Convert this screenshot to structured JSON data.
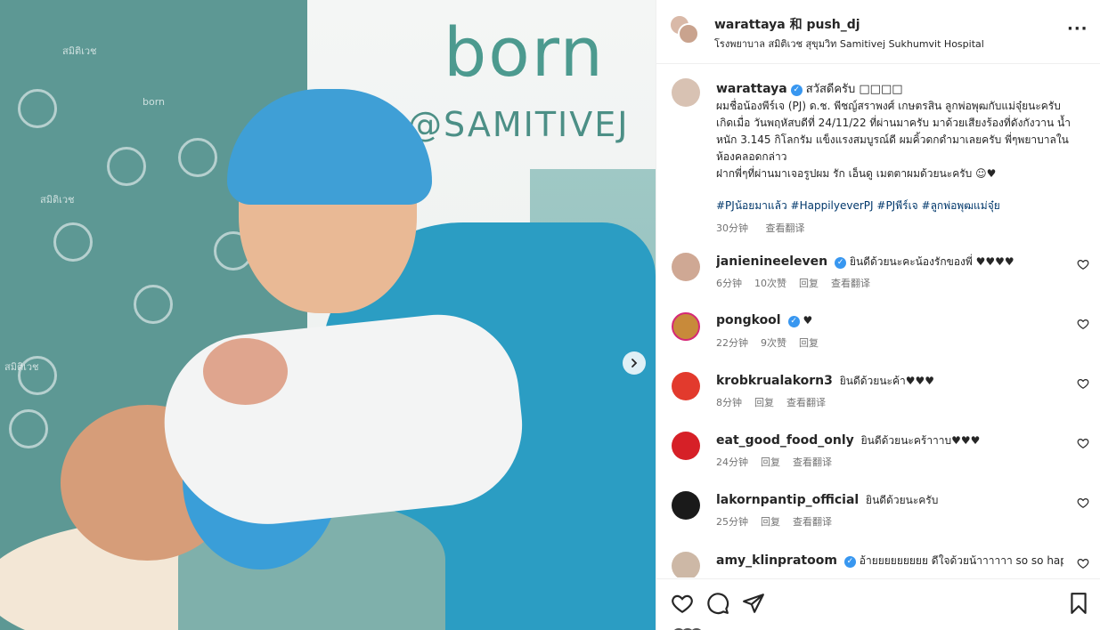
{
  "photo": {
    "logo_text": "born",
    "logo_sub": "@SAMITIVEJ",
    "pattern_text": "สมิติเวช",
    "next_icon": "chevron-right-icon"
  },
  "header": {
    "user_label": "warattaya 和 push_dj",
    "location": "โรงพยาบาล สมิติเวช สุขุมวิท Samitivej Sukhumvit Hospital",
    "more_label": "···"
  },
  "caption": {
    "user": "warattaya",
    "greeting": "สวัสดีครับ □□□□",
    "lines": [
      "ผมชื่อน้องพีร์เจ (PJ) ด.ช. พีชญ์สราพงศ์ เกษตรสิน ลูกพ่อพุฒกับแม่จุ๋ยนะครับ",
      "เกิดเมื่อ วันพฤหัสบดีที่ 24/11/22 ที่ผ่านมาครับ มาด้วยเสียงร้องที่ดังกังวาน น้ำหนัก 3.145 กิโลกรัม แข็งแรงสมบูรณ์ดี ผมคิ้วดกดำมาเลยครับ พี่ๆพยาบาลในห้องคลอดกล่าว",
      "ฝากพี่ๆที่ผ่านมาเจอรูปผม รัก เอ็นดู เมตตาผมด้วยนะครับ ☺︎♥"
    ],
    "hashtags": "#PJน้อยมาแล้ว #HappilyeverPJ #PJพีร์เจ #ลูกพ่อพุฒแม่จุ๋ย",
    "time": "30分钟",
    "translate": "查看翻译"
  },
  "comments": [
    {
      "user": "janienineeleven",
      "verified": true,
      "text": "ยินดีด้วยนะคะน้องรักของพี่ ♥♥♥♥",
      "time": "6分钟",
      "likes": "10次赞",
      "reply": "回复",
      "translate": "查看翻译",
      "avatar_color": "#cfa894"
    },
    {
      "user": "pongkool",
      "verified": true,
      "text": "♥",
      "time": "22分钟",
      "likes": "9次赞",
      "reply": "回复",
      "translate": "",
      "avatar_color": "#c88a3a"
    },
    {
      "user": "krobkrualakorn3",
      "verified": false,
      "text": "ยินดีด้วยนะค้า♥♥♥",
      "time": "8分钟",
      "likes": "",
      "reply": "回复",
      "translate": "查看翻译",
      "avatar_color": "#e23a2d"
    },
    {
      "user": "eat_good_food_only",
      "verified": false,
      "text": "ยินดีด้วยนะคร้าาาบ♥♥♥",
      "time": "24分钟",
      "likes": "",
      "reply": "回复",
      "translate": "查看翻译",
      "avatar_color": "#d62027"
    },
    {
      "user": "lakornpantip_official",
      "verified": false,
      "text": "ยินดีด้วยนะครับ",
      "time": "25分钟",
      "likes": "",
      "reply": "回复",
      "translate": "查看翻译",
      "avatar_color": "#1a1a1a"
    },
    {
      "user": "amy_klinpratoom",
      "verified": true,
      "text": "อ้ายยยยยยยยย ดีใจด้วยน้าาาาาา so so happy",
      "time": "",
      "likes": "",
      "reply": "",
      "translate": "",
      "avatar_color": "#cdb8a6"
    }
  ],
  "actions": {
    "like_icon": "heart-icon",
    "comment_icon": "comment-icon",
    "share_icon": "paper-plane-icon",
    "save_icon": "bookmark-icon"
  }
}
